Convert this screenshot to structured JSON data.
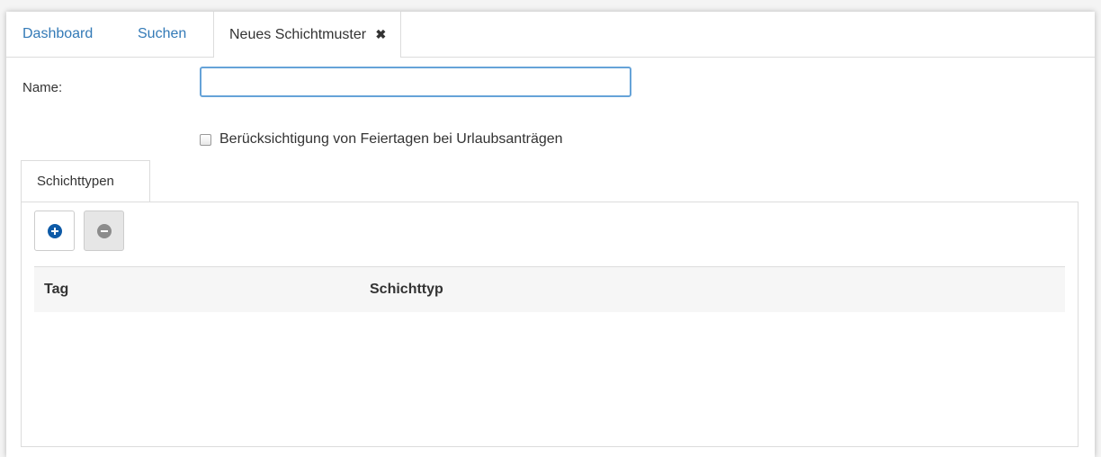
{
  "tabs": [
    {
      "label": "Dashboard"
    },
    {
      "label": "Suchen"
    },
    {
      "label": "Neues Schichtmuster",
      "close": "✖"
    }
  ],
  "form": {
    "name_label": "Name:",
    "name_value": "",
    "holiday_checkbox_label": "Berücksichtigung von Feiertagen bei Urlaubsanträgen",
    "holiday_checkbox_checked": false
  },
  "inner_tab": {
    "label": "Schichttypen"
  },
  "toolbar": {
    "add_icon": "plus-circle-icon",
    "remove_icon": "minus-circle-icon"
  },
  "table": {
    "columns": [
      "Tag",
      "Schichttyp"
    ],
    "rows": []
  },
  "colors": {
    "link": "#337ab7",
    "add_icon": "#0d5aa7",
    "input_focus_border": "#66a3d8"
  }
}
